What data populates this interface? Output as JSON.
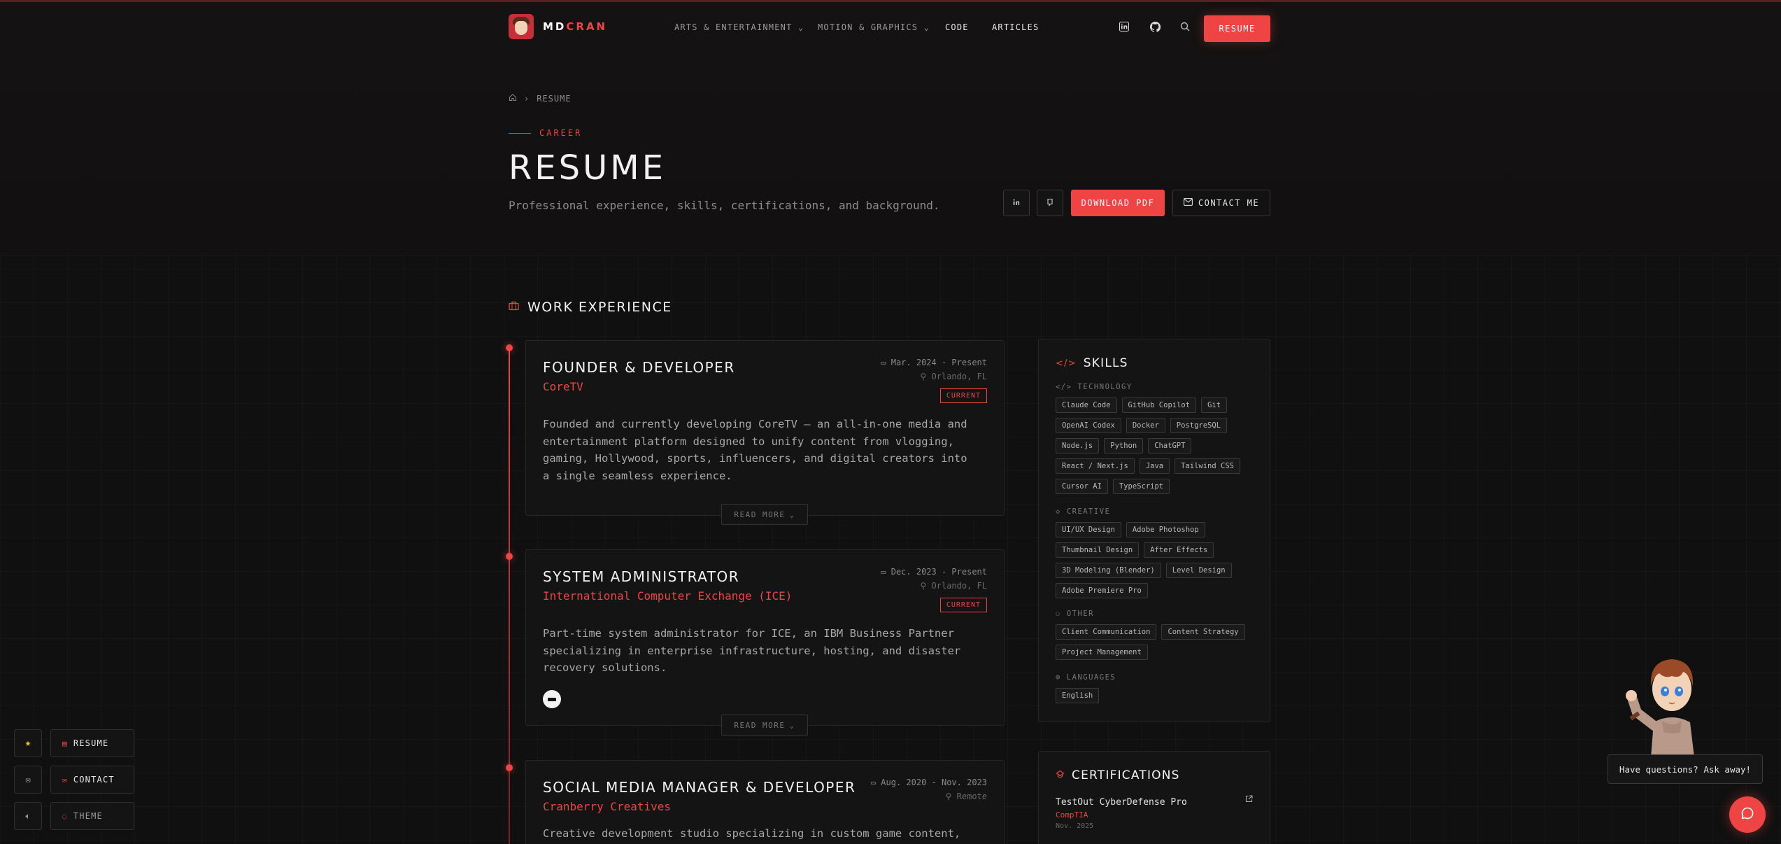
{
  "brand": {
    "name_part1": "MD",
    "name_part2": "CRAN"
  },
  "nav": {
    "items": [
      {
        "label": "ARTS & ENTERTAINMENT ⌄"
      },
      {
        "label": "MOTION & GRAPHICS ⌄"
      },
      {
        "label": "CODE"
      },
      {
        "label": "ARTICLES"
      }
    ],
    "resume_label": "RESUME"
  },
  "breadcrumb": {
    "current": "RESUME"
  },
  "hero": {
    "eyebrow": "CAREER",
    "title": "RESUME",
    "subtitle": "Professional experience, skills, certifications, and background.",
    "download_label": "DOWNLOAD PDF",
    "contact_label": "CONTACT ME"
  },
  "experience": {
    "title": "WORK EXPERIENCE",
    "read_more_label": "READ MORE",
    "jobs": [
      {
        "role": "FOUNDER & DEVELOPER",
        "company": "CoreTV",
        "date": "Mar. 2024 - Present",
        "location": "Orlando, FL",
        "badge": "CURRENT",
        "description": "Founded and currently developing CoreTV — an all-in-one media and entertainment platform designed to unify content from vlogging, gaming, Hollywood, sports, influencers, and digital creators into a single seamless experience."
      },
      {
        "role": "SYSTEM ADMINISTRATOR",
        "company": "International Computer Exchange (ICE)",
        "date": "Dec. 2023 - Present",
        "location": "Orlando, FL",
        "badge": "CURRENT",
        "description": "Part-time system administrator for ICE, an IBM Business Partner specializing in enterprise infrastructure, hosting, and disaster recovery solutions."
      },
      {
        "role": "SOCIAL MEDIA MANAGER & DEVELOPER",
        "company": "Cranberry Creatives",
        "date": "Aug. 2020 - Nov. 2023",
        "location": "Remote",
        "description": "Creative development studio specializing in custom game content,"
      }
    ]
  },
  "skills": {
    "title": "SKILLS",
    "groups": [
      {
        "label": "TECHNOLOGY",
        "tags": [
          "Claude Code",
          "GitHub Copilot",
          "Git",
          "OpenAI Codex",
          "Docker",
          "PostgreSQL",
          "Node.js",
          "Python",
          "ChatGPT",
          "React / Next.js",
          "Java",
          "Tailwind CSS",
          "Cursor AI",
          "TypeScript"
        ]
      },
      {
        "label": "CREATIVE",
        "tags": [
          "UI/UX Design",
          "Adobe Photoshop",
          "Thumbnail Design",
          "After Effects",
          "3D Modeling (Blender)",
          "Level Design",
          "Adobe Premiere Pro"
        ]
      },
      {
        "label": "OTHER",
        "tags": [
          "Client Communication",
          "Content Strategy",
          "Project Management"
        ]
      },
      {
        "label": "LANGUAGES",
        "tags": [
          "English"
        ]
      }
    ]
  },
  "certifications": {
    "title": "CERTIFICATIONS",
    "items": [
      {
        "name": "TestOut CyberDefense Pro",
        "org": "CompTIA",
        "date": "Nov. 2025"
      }
    ]
  },
  "floating": {
    "resume_label": "RESUME",
    "contact_label": "CONTACT",
    "theme_label": "THEME"
  },
  "chat": {
    "prompt": "Have questions? Ask away!"
  },
  "colors": {
    "accent": "#ef4444",
    "background": "#101010",
    "card": "#141414"
  }
}
